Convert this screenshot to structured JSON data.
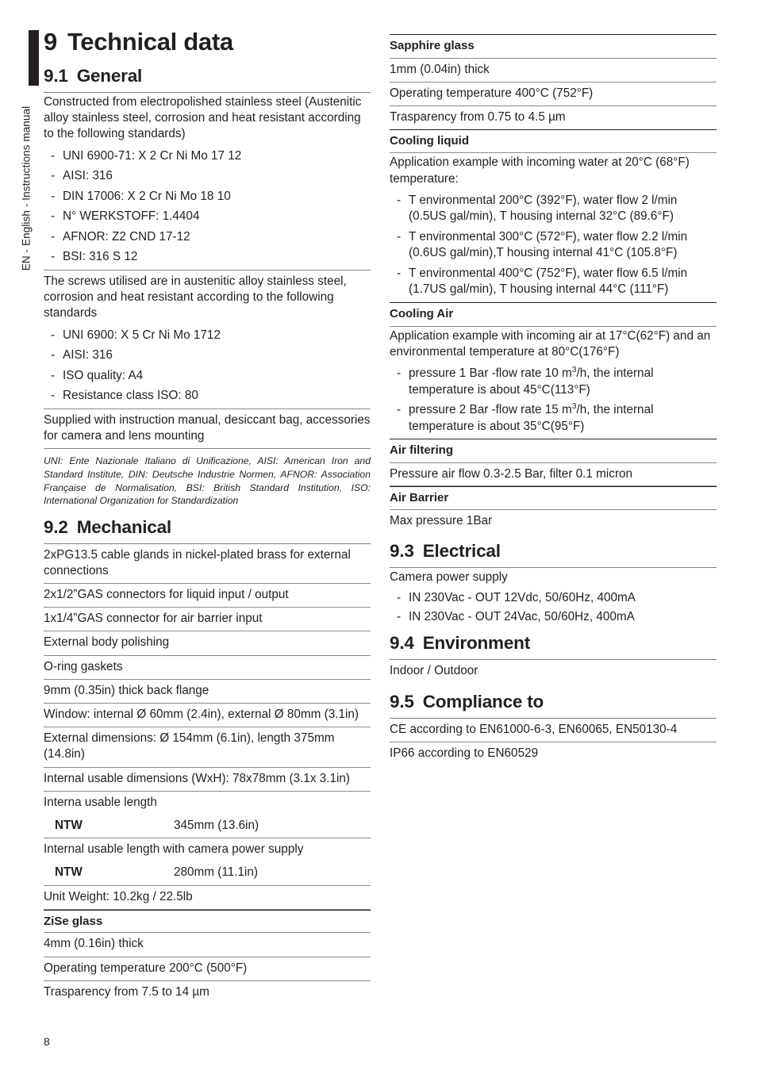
{
  "sidebar": {
    "label": "EN - English - Instructions manual"
  },
  "chapter": {
    "number": "9",
    "title": "Technical data"
  },
  "page_number": "8",
  "sections": {
    "general": {
      "number": "9.1",
      "title": "General",
      "intro": "Constructed from electropolished stainless steel (Austenitic alloy stainless steel, corrosion and heat resistant according to the following standards)",
      "standards": [
        "UNI 6900-71: X 2 Cr Ni Mo 17 12",
        "AISI: 316",
        "DIN 17006: X 2 Cr Ni Mo 18 10",
        "N° WERKSTOFF: 1.4404",
        "AFNOR: Z2 CND 17-12",
        "BSI: 316 S 12"
      ],
      "screws_intro": "The screws utilised are in austenitic alloy stainless steel, corrosion and heat resistant according to the following standards",
      "screws_standards": [
        "UNI 6900: X 5 Cr Ni Mo 1712",
        "AISI: 316",
        "ISO quality: A4",
        "Resistance class ISO: 80"
      ],
      "supplied": "Supplied with instruction manual, desiccant bag, accessories for camera and lens mounting",
      "footnote": "UNI: Ente Nazionale Italiano di Unificazione, AISI: American Iron and Standard Institute, DIN: Deutsche Industrie Normen, AFNOR: Association Française de Normalisation, BSI: British Standard Institution, ISO: International Organization for Standardization"
    },
    "mechanical": {
      "number": "9.2",
      "title": "Mechanical",
      "rows": [
        "2xPG13.5 cable glands in nickel-plated brass for external connections",
        "2x1/2”GAS connectors for liquid input / output",
        "1x1/4”GAS connector for air barrier input",
        "External body polishing",
        "O-ring gaskets",
        "9mm (0.35in) thick back flange",
        "Window: internal Ø 60mm (2.4in), external Ø 80mm (3.1in)",
        "External dimensions: Ø 154mm (6.1in), length 375mm (14.8in)",
        "Internal usable dimensions (WxH): 78x78mm (3.1x 3.1in)"
      ],
      "usable_length_label": "Interna usable length",
      "usable_length_key": "NTW",
      "usable_length_value": "345mm (13.6in)",
      "usable_length_ps_label": "Internal usable length with camera power supply",
      "usable_length_ps_key": "NTW",
      "usable_length_ps_value": "280mm (11.1in)",
      "unit_weight": "Unit Weight: 10.2kg / 22.5lb",
      "zise": {
        "header": "ZiSe glass",
        "rows": [
          "4mm (0.16in) thick",
          "Operating temperature 200°C (500°F)",
          "Trasparency from 7.5 to 14 µm"
        ]
      }
    },
    "sapphire": {
      "header": "Sapphire glass",
      "rows": [
        "1mm (0.04in) thick",
        "Operating temperature 400°C (752°F)",
        "Trasparency from 0.75 to 4.5 µm"
      ]
    },
    "cooling_liquid": {
      "header": "Cooling liquid",
      "intro": "Application example with incoming water at 20°C (68°F) temperature:",
      "items": [
        "T environmental 200°C (392°F), water flow 2 l/min (0.5US gal/min), T housing internal 32°C (89.6°F)",
        "T environmental 300°C (572°F), water flow 2.2 l/min (0.6US gal/min),T housing internal 41°C (105.8°F)",
        "T environmental 400°C (752°F), water flow 6.5 l/min (1.7US gal/min), T housing internal 44°C (111°F)"
      ]
    },
    "cooling_air": {
      "header": "Cooling Air",
      "intro": "Application example with incoming air at 17°C(62°F) and an environmental temperature at 80°C(176°F)",
      "items": [
        {
          "pre": "pressure 1 Bar -flow rate 10 m",
          "sup": "3",
          "post": "/h, the internal temperature is about 45°C(113°F)"
        },
        {
          "pre": "pressure 2 Bar -flow rate 15 m",
          "sup": "3",
          "post": "/h, the internal temperature is about 35°C(95°F)"
        }
      ]
    },
    "air_filtering": {
      "header": "Air filtering",
      "row": "Pressure air flow 0.3-2.5 Bar, filter 0.1 micron"
    },
    "air_barrier": {
      "header": "Air Barrier",
      "row": "Max pressure 1Bar"
    },
    "electrical": {
      "number": "9.3",
      "title": "Electrical",
      "intro": "Camera power supply",
      "items": [
        "IN 230Vac - OUT 12Vdc, 50/60Hz, 400mA",
        "IN 230Vac - OUT 24Vac, 50/60Hz, 400mA"
      ]
    },
    "environment": {
      "number": "9.4",
      "title": "Environment",
      "row": "Indoor / Outdoor"
    },
    "compliance": {
      "number": "9.5",
      "title": "Compliance to",
      "rows": [
        "CE according to EN61000-6-3, EN60065, EN50130-4",
        "IP66 according to EN60529"
      ]
    }
  }
}
